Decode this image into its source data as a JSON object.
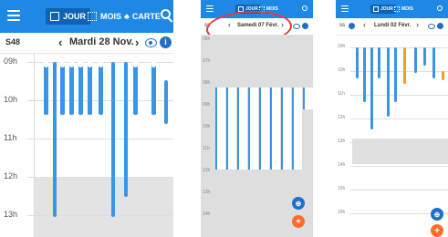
{
  "screen1": {
    "tabs": [
      {
        "label": "JOUR",
        "icon": "calendar-day-icon"
      },
      {
        "label": "MOIS",
        "icon": "calendar-grid-icon"
      },
      {
        "label": "CARTE",
        "icon": "map-people-icon"
      }
    ],
    "week": "S48",
    "date_label": "Mardi 28 Nov.",
    "hours": [
      "09h",
      "10h",
      "11h",
      "12h",
      "13h"
    ]
  },
  "screen2": {
    "tabs": [
      {
        "label": "JOUR"
      },
      {
        "label": "MOIS"
      }
    ],
    "week": "ss",
    "date_label": "Samedi 07 Févr.",
    "hours": [
      "06h",
      "07h",
      "08h",
      "09h",
      "10h",
      "11h",
      "12h",
      "13h",
      "14h"
    ],
    "fab_zoom": "⊕",
    "fab_add": "+",
    "highlight_color": "#e03a3a"
  },
  "screen3": {
    "tabs": [
      {
        "label": "JOUR"
      },
      {
        "label": "MOIS"
      }
    ],
    "week": "ss",
    "date_label": "Lundi 02 Févr.",
    "hours": [
      "09h",
      "10h",
      "11h",
      "12h",
      "13h",
      "14h",
      "15h",
      "16h"
    ],
    "fab_zoom": "⊕",
    "fab_add": "+"
  },
  "colors": {
    "primary": "#1f88e5",
    "event": "#3a95e6",
    "event_alt": "#f4a020",
    "fab_add": "#ff6d2d"
  }
}
